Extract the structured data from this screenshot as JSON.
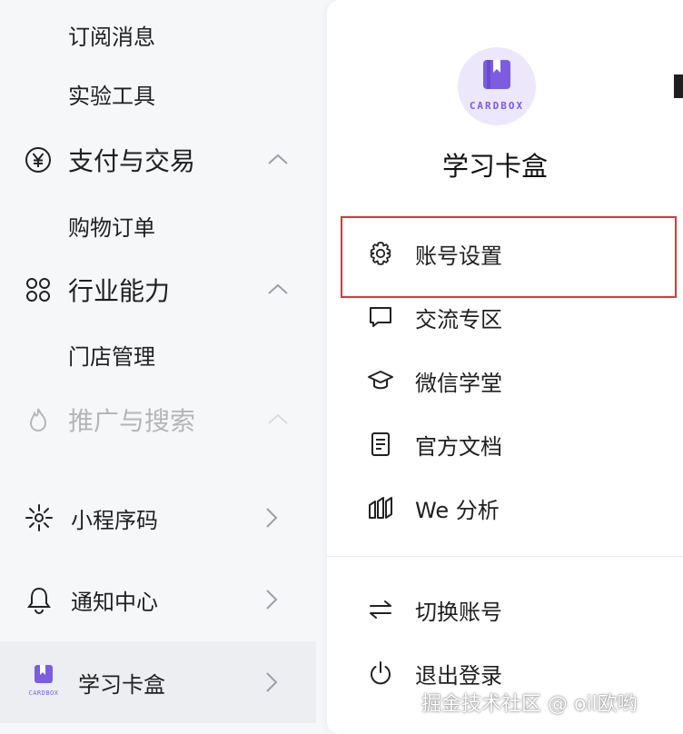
{
  "sidebar": {
    "subscription_messages": "订阅消息",
    "lab_tools": "实验工具",
    "payments": {
      "label": "支付与交易",
      "items": [
        "购物订单"
      ]
    },
    "industry": {
      "label": "行业能力",
      "items": [
        "门店管理"
      ]
    },
    "promotion": {
      "label": "推广与搜索"
    },
    "mini_code": "小程序码",
    "notifications": "通知中心",
    "account": "学习卡盒",
    "account_logo_text": "CARDBOX"
  },
  "panel": {
    "avatar_text": "CARDBOX",
    "account_name": "学习卡盒",
    "menu": [
      {
        "label": "账号设置",
        "icon": "gear-icon"
      },
      {
        "label": "交流专区",
        "icon": "chat-bubble-icon"
      },
      {
        "label": "微信学堂",
        "icon": "graduation-cap-icon"
      },
      {
        "label": "官方文档",
        "icon": "document-icon"
      },
      {
        "label": "We 分析",
        "icon": "analytics-icon"
      }
    ],
    "switch_account": "切换账号",
    "logout": "退出登录"
  },
  "watermark": "掘金技术社区 @ oil欧哟",
  "colors": {
    "highlight": "#d9363e",
    "brand": "#7c5ce0",
    "sidebar_bg": "#f6f7f9"
  }
}
